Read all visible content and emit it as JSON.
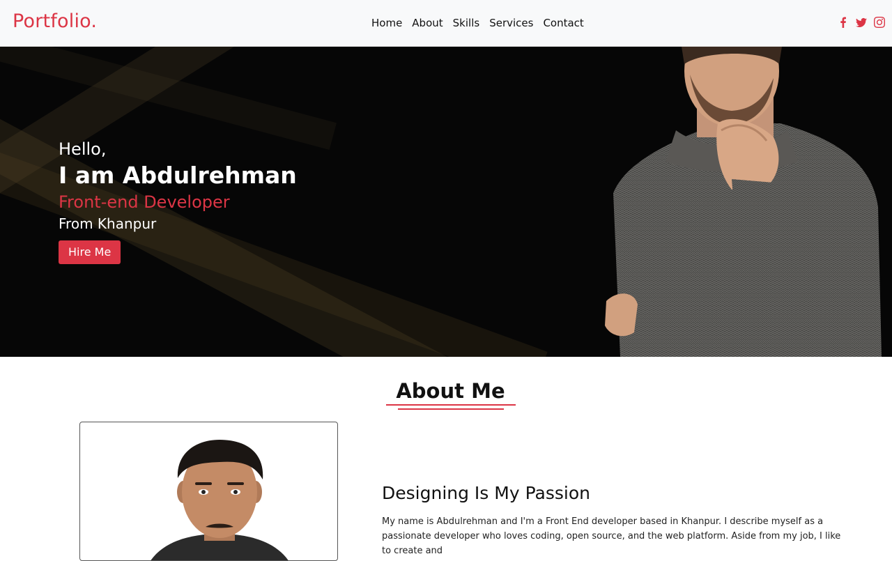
{
  "navbar": {
    "brand": "Portfolio.",
    "links": [
      "Home",
      "About",
      "Skills",
      "Services",
      "Contact"
    ],
    "socials": [
      "facebook-icon",
      "twitter-icon",
      "instagram-icon"
    ]
  },
  "hero": {
    "greeting": "Hello,",
    "name": "I am Abdulrehman",
    "role": "Front-end Developer",
    "from": "From Khanpur",
    "button": "Hire Me"
  },
  "about": {
    "title": "About Me",
    "subtitle": "Designing Is My Passion",
    "text": "My name is Abdulrehman and I'm a Front End developer based in Khanpur. I describe myself as a passionate developer who loves coding, open source, and the web platform. Aside from my job, I like to create and"
  },
  "colors": {
    "accent": "#dc3545",
    "hero_bg": "#060606",
    "navbar_bg": "#f8f9fa"
  }
}
